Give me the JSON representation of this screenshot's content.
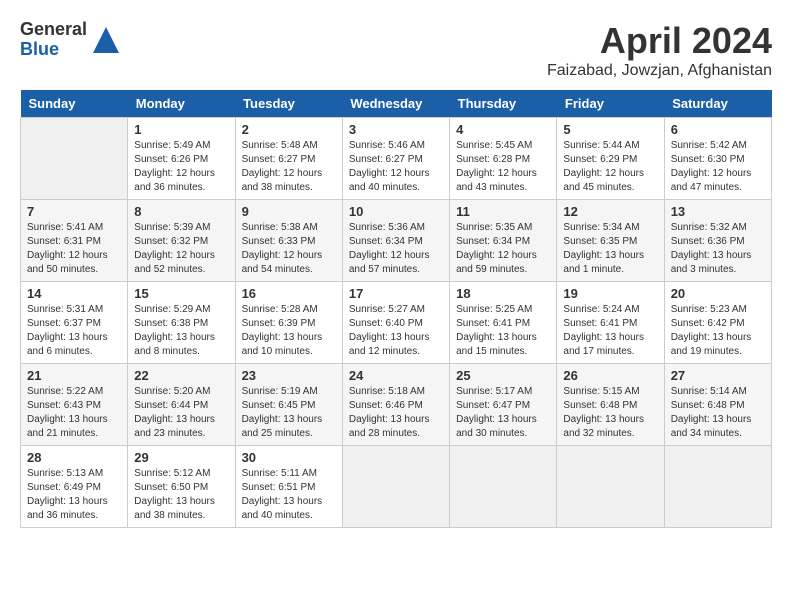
{
  "header": {
    "logo_general": "General",
    "logo_blue": "Blue",
    "title": "April 2024",
    "location": "Faizabad, Jowzjan, Afghanistan"
  },
  "days_of_week": [
    "Sunday",
    "Monday",
    "Tuesday",
    "Wednesday",
    "Thursday",
    "Friday",
    "Saturday"
  ],
  "weeks": [
    [
      {
        "day": "",
        "empty": true
      },
      {
        "day": "1",
        "sunrise": "Sunrise: 5:49 AM",
        "sunset": "Sunset: 6:26 PM",
        "daylight": "Daylight: 12 hours and 36 minutes."
      },
      {
        "day": "2",
        "sunrise": "Sunrise: 5:48 AM",
        "sunset": "Sunset: 6:27 PM",
        "daylight": "Daylight: 12 hours and 38 minutes."
      },
      {
        "day": "3",
        "sunrise": "Sunrise: 5:46 AM",
        "sunset": "Sunset: 6:27 PM",
        "daylight": "Daylight: 12 hours and 40 minutes."
      },
      {
        "day": "4",
        "sunrise": "Sunrise: 5:45 AM",
        "sunset": "Sunset: 6:28 PM",
        "daylight": "Daylight: 12 hours and 43 minutes."
      },
      {
        "day": "5",
        "sunrise": "Sunrise: 5:44 AM",
        "sunset": "Sunset: 6:29 PM",
        "daylight": "Daylight: 12 hours and 45 minutes."
      },
      {
        "day": "6",
        "sunrise": "Sunrise: 5:42 AM",
        "sunset": "Sunset: 6:30 PM",
        "daylight": "Daylight: 12 hours and 47 minutes."
      }
    ],
    [
      {
        "day": "7",
        "sunrise": "Sunrise: 5:41 AM",
        "sunset": "Sunset: 6:31 PM",
        "daylight": "Daylight: 12 hours and 50 minutes."
      },
      {
        "day": "8",
        "sunrise": "Sunrise: 5:39 AM",
        "sunset": "Sunset: 6:32 PM",
        "daylight": "Daylight: 12 hours and 52 minutes."
      },
      {
        "day": "9",
        "sunrise": "Sunrise: 5:38 AM",
        "sunset": "Sunset: 6:33 PM",
        "daylight": "Daylight: 12 hours and 54 minutes."
      },
      {
        "day": "10",
        "sunrise": "Sunrise: 5:36 AM",
        "sunset": "Sunset: 6:34 PM",
        "daylight": "Daylight: 12 hours and 57 minutes."
      },
      {
        "day": "11",
        "sunrise": "Sunrise: 5:35 AM",
        "sunset": "Sunset: 6:34 PM",
        "daylight": "Daylight: 12 hours and 59 minutes."
      },
      {
        "day": "12",
        "sunrise": "Sunrise: 5:34 AM",
        "sunset": "Sunset: 6:35 PM",
        "daylight": "Daylight: 13 hours and 1 minute."
      },
      {
        "day": "13",
        "sunrise": "Sunrise: 5:32 AM",
        "sunset": "Sunset: 6:36 PM",
        "daylight": "Daylight: 13 hours and 3 minutes."
      }
    ],
    [
      {
        "day": "14",
        "sunrise": "Sunrise: 5:31 AM",
        "sunset": "Sunset: 6:37 PM",
        "daylight": "Daylight: 13 hours and 6 minutes."
      },
      {
        "day": "15",
        "sunrise": "Sunrise: 5:29 AM",
        "sunset": "Sunset: 6:38 PM",
        "daylight": "Daylight: 13 hours and 8 minutes."
      },
      {
        "day": "16",
        "sunrise": "Sunrise: 5:28 AM",
        "sunset": "Sunset: 6:39 PM",
        "daylight": "Daylight: 13 hours and 10 minutes."
      },
      {
        "day": "17",
        "sunrise": "Sunrise: 5:27 AM",
        "sunset": "Sunset: 6:40 PM",
        "daylight": "Daylight: 13 hours and 12 minutes."
      },
      {
        "day": "18",
        "sunrise": "Sunrise: 5:25 AM",
        "sunset": "Sunset: 6:41 PM",
        "daylight": "Daylight: 13 hours and 15 minutes."
      },
      {
        "day": "19",
        "sunrise": "Sunrise: 5:24 AM",
        "sunset": "Sunset: 6:41 PM",
        "daylight": "Daylight: 13 hours and 17 minutes."
      },
      {
        "day": "20",
        "sunrise": "Sunrise: 5:23 AM",
        "sunset": "Sunset: 6:42 PM",
        "daylight": "Daylight: 13 hours and 19 minutes."
      }
    ],
    [
      {
        "day": "21",
        "sunrise": "Sunrise: 5:22 AM",
        "sunset": "Sunset: 6:43 PM",
        "daylight": "Daylight: 13 hours and 21 minutes."
      },
      {
        "day": "22",
        "sunrise": "Sunrise: 5:20 AM",
        "sunset": "Sunset: 6:44 PM",
        "daylight": "Daylight: 13 hours and 23 minutes."
      },
      {
        "day": "23",
        "sunrise": "Sunrise: 5:19 AM",
        "sunset": "Sunset: 6:45 PM",
        "daylight": "Daylight: 13 hours and 25 minutes."
      },
      {
        "day": "24",
        "sunrise": "Sunrise: 5:18 AM",
        "sunset": "Sunset: 6:46 PM",
        "daylight": "Daylight: 13 hours and 28 minutes."
      },
      {
        "day": "25",
        "sunrise": "Sunrise: 5:17 AM",
        "sunset": "Sunset: 6:47 PM",
        "daylight": "Daylight: 13 hours and 30 minutes."
      },
      {
        "day": "26",
        "sunrise": "Sunrise: 5:15 AM",
        "sunset": "Sunset: 6:48 PM",
        "daylight": "Daylight: 13 hours and 32 minutes."
      },
      {
        "day": "27",
        "sunrise": "Sunrise: 5:14 AM",
        "sunset": "Sunset: 6:48 PM",
        "daylight": "Daylight: 13 hours and 34 minutes."
      }
    ],
    [
      {
        "day": "28",
        "sunrise": "Sunrise: 5:13 AM",
        "sunset": "Sunset: 6:49 PM",
        "daylight": "Daylight: 13 hours and 36 minutes."
      },
      {
        "day": "29",
        "sunrise": "Sunrise: 5:12 AM",
        "sunset": "Sunset: 6:50 PM",
        "daylight": "Daylight: 13 hours and 38 minutes."
      },
      {
        "day": "30",
        "sunrise": "Sunrise: 5:11 AM",
        "sunset": "Sunset: 6:51 PM",
        "daylight": "Daylight: 13 hours and 40 minutes."
      },
      {
        "day": "",
        "empty": true
      },
      {
        "day": "",
        "empty": true
      },
      {
        "day": "",
        "empty": true
      },
      {
        "day": "",
        "empty": true
      }
    ]
  ]
}
